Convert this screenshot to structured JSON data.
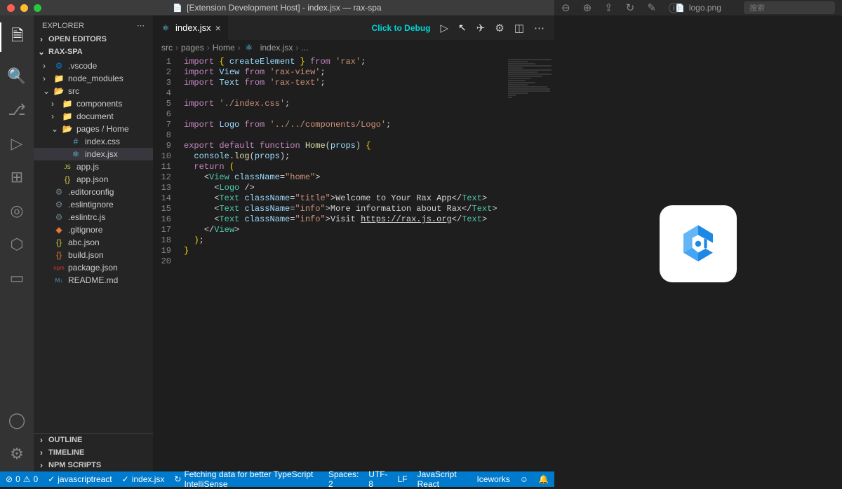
{
  "window1": {
    "title": "[Extension Development Host] - index.jsx — rax-spa"
  },
  "window2": {
    "title": "logo.png",
    "toolbar_icons": [
      "zoom-out",
      "zoom-in",
      "share",
      "rotate",
      "edit",
      "info"
    ],
    "search_placeholder": "搜索"
  },
  "explorer": {
    "title": "EXPLORER",
    "sections": {
      "open_editors": "OPEN EDITORS",
      "project": "RAX-SPA",
      "outline": "OUTLINE",
      "timeline": "TIMELINE",
      "npm_scripts": "NPM SCRIPTS"
    },
    "tree": [
      {
        "depth": 0,
        "chev": "›",
        "icon": "vscode",
        "label": ".vscode"
      },
      {
        "depth": 0,
        "chev": "›",
        "icon": "folder",
        "label": "node_modules"
      },
      {
        "depth": 0,
        "chev": "⌄",
        "icon": "folder-open",
        "label": "src"
      },
      {
        "depth": 1,
        "chev": "›",
        "icon": "folder",
        "label": "components"
      },
      {
        "depth": 1,
        "chev": "›",
        "icon": "folder",
        "label": "document"
      },
      {
        "depth": 1,
        "chev": "⌄",
        "icon": "folder-open",
        "label": "pages / Home"
      },
      {
        "depth": 2,
        "chev": "",
        "icon": "css",
        "label": "index.css"
      },
      {
        "depth": 2,
        "chev": "",
        "icon": "react",
        "label": "index.jsx",
        "selected": true
      },
      {
        "depth": 1,
        "chev": "",
        "icon": "js",
        "label": "app.js"
      },
      {
        "depth": 1,
        "chev": "",
        "icon": "json",
        "label": "app.json"
      },
      {
        "depth": 0,
        "chev": "",
        "icon": "config",
        "label": ".editorconfig"
      },
      {
        "depth": 0,
        "chev": "",
        "icon": "config",
        "label": ".eslintignore"
      },
      {
        "depth": 0,
        "chev": "",
        "icon": "config",
        "label": ".eslintrc.js"
      },
      {
        "depth": 0,
        "chev": "",
        "icon": "git",
        "label": ".gitignore"
      },
      {
        "depth": 0,
        "chev": "",
        "icon": "json",
        "label": "abc.json"
      },
      {
        "depth": 0,
        "chev": "",
        "icon": "json-b",
        "label": "build.json"
      },
      {
        "depth": 0,
        "chev": "",
        "icon": "npm",
        "label": "package.json"
      },
      {
        "depth": 0,
        "chev": "",
        "icon": "md",
        "label": "README.md"
      }
    ]
  },
  "editor": {
    "tab": "index.jsx",
    "debug_hint": "Click to Debug",
    "breadcrumb": [
      "src",
      "pages",
      "Home",
      "index.jsx",
      "..."
    ],
    "code": [
      {
        "n": 1,
        "html": "<span class='k'>import</span> <span class='br'>{</span> <span class='p'>createElement</span> <span class='br'>}</span> <span class='k'>from</span> <span class='s'>'rax'</span>;"
      },
      {
        "n": 2,
        "html": "<span class='k'>import</span> <span class='p'>View</span> <span class='k'>from</span> <span class='s'>'rax-view'</span>;"
      },
      {
        "n": 3,
        "html": "<span class='k'>import</span> <span class='p'>Text</span> <span class='k'>from</span> <span class='s'>'rax-text'</span>;"
      },
      {
        "n": 4,
        "html": ""
      },
      {
        "n": 5,
        "html": "<span class='k'>import</span> <span class='s'>'./index.css'</span>;"
      },
      {
        "n": 6,
        "html": ""
      },
      {
        "n": 7,
        "html": "<span class='k'>import</span> <span class='p'>Logo</span> <span class='k'>from</span> <span class='s'>'../../components/Logo'</span>;"
      },
      {
        "n": 8,
        "html": ""
      },
      {
        "n": 9,
        "html": "<span class='k'>export</span> <span class='k'>default</span> <span class='k'>function</span> <span class='f'>Home</span>(<span class='p'>props</span>) <span class='br'>{</span>"
      },
      {
        "n": 10,
        "html": "  <span class='p'>console</span>.<span class='f'>log</span>(<span class='p'>props</span>);"
      },
      {
        "n": 11,
        "html": "  <span class='k'>return</span> <span class='br'>(</span>"
      },
      {
        "n": 12,
        "html": "    <span class='c'>&lt;</span><span class='t'>View</span> <span class='p'>className</span>=<span class='s'>\"home\"</span><span class='c'>&gt;</span>"
      },
      {
        "n": 13,
        "html": "      <span class='c'>&lt;</span><span class='t'>Logo</span> <span class='c'>/&gt;</span>"
      },
      {
        "n": 14,
        "html": "      <span class='c'>&lt;</span><span class='t'>Text</span> <span class='p'>className</span>=<span class='s'>\"title\"</span><span class='c'>&gt;</span>Welcome to Your Rax App<span class='c'>&lt;/</span><span class='t'>Text</span><span class='c'>&gt;</span>"
      },
      {
        "n": 15,
        "html": "      <span class='c'>&lt;</span><span class='t'>Text</span> <span class='p'>className</span>=<span class='s'>\"info\"</span><span class='c'>&gt;</span>More information about Rax<span class='c'>&lt;/</span><span class='t'>Text</span><span class='c'>&gt;</span>"
      },
      {
        "n": 16,
        "html": "      <span class='c'>&lt;</span><span class='t'>Text</span> <span class='p'>className</span>=<span class='s'>\"info\"</span><span class='c'>&gt;</span>Visit <span class='u'>https://rax.js.org</span><span class='c'>&lt;/</span><span class='t'>Text</span><span class='c'>&gt;</span>"
      },
      {
        "n": 17,
        "html": "    <span class='c'>&lt;/</span><span class='t'>View</span><span class='c'>&gt;</span>"
      },
      {
        "n": 18,
        "html": "  <span class='br'>)</span>;"
      },
      {
        "n": 19,
        "html": "<span class='br'>}</span>"
      },
      {
        "n": 20,
        "html": ""
      }
    ]
  },
  "status": {
    "errors": "0",
    "warnings": "0",
    "lang_mode": "javascriptreact",
    "file": "index.jsx",
    "ts_msg": "Fetching data for better TypeScript IntelliSense",
    "spaces": "Spaces: 2",
    "encoding": "UTF-8",
    "eol": "LF",
    "language": "JavaScript React",
    "iceworks": "Iceworks"
  }
}
